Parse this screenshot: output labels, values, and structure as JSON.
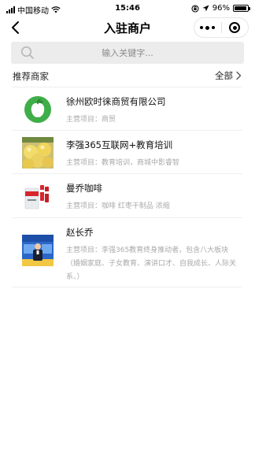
{
  "status_bar": {
    "carrier": "中国移动",
    "time": "15:46",
    "battery": "96%",
    "battery_level": 0.96
  },
  "nav": {
    "title": "入驻商户"
  },
  "search": {
    "placeholder": "输入关键字..."
  },
  "section": {
    "title": "推荐商家",
    "see_all": "全部"
  },
  "merchants": [
    {
      "name": "徐州欧时徕商贸有限公司",
      "desc": "主营项目：商贸",
      "thumb": "apple-logo"
    },
    {
      "name": "李强365互联网+教育培训",
      "desc": "主营项目：教育培训，商城中影睿智",
      "thumb": "pear-photo"
    },
    {
      "name": "曼乔咖啡",
      "desc": "主营项目：咖啡 红枣干制品 浓缩",
      "thumb": "coffee-product"
    },
    {
      "name": "赵长乔",
      "desc": "主营项目：李强365教育终身推动者，包含八大板块（婚姻家庭、子女教育、演讲口才、自我成长、人际关系、）",
      "thumb": "promo-poster"
    }
  ]
}
